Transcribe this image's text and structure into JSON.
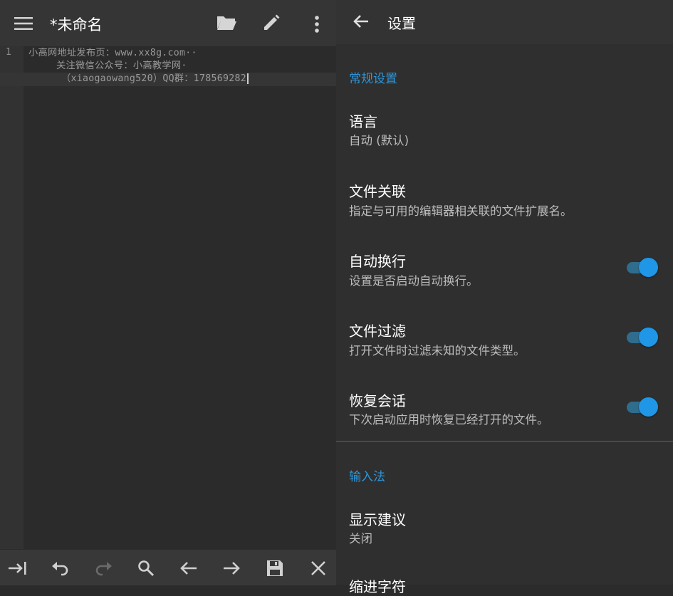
{
  "editor": {
    "title": "*未命名",
    "line_number": "1",
    "lines": [
      "小高网地址发布页：www.xx8g.com··",
      "关注微信公众号：小高教学网·",
      "（xiaogaowang520）QQ群：178569282"
    ],
    "icons": {
      "menu": "menu-icon",
      "open": "folder-open-icon",
      "edit": "pencil-icon",
      "more": "more-vert-icon",
      "tab": "tab-indent-icon",
      "undo": "undo-icon",
      "redo": "redo-icon",
      "search": "search-icon",
      "prev": "arrow-left-icon",
      "next": "arrow-right-icon",
      "save": "save-icon",
      "close": "close-icon"
    }
  },
  "settings": {
    "title": "设置",
    "sections": {
      "general": "常规设置",
      "input": "输入法"
    },
    "items": [
      {
        "title": "语言",
        "subtitle": "自动 (默认)"
      },
      {
        "title": "文件关联",
        "subtitle": "指定与可用的编辑器相关联的文件扩展名。"
      },
      {
        "title": "自动换行",
        "subtitle": "设置是否启动自动换行。",
        "enabled": true
      },
      {
        "title": "文件过滤",
        "subtitle": "打开文件时过滤未知的文件类型。",
        "enabled": true
      },
      {
        "title": "恢复会话",
        "subtitle": "下次启动应用时恢复已经打开的文件。",
        "enabled": true
      },
      {
        "title": "显示建议",
        "subtitle": "关闭"
      },
      {
        "title": "缩进字符"
      }
    ]
  },
  "colors": {
    "accent": "#2f95d8",
    "toggle_on": "#1f97e6",
    "background": "#2b2b2b"
  }
}
